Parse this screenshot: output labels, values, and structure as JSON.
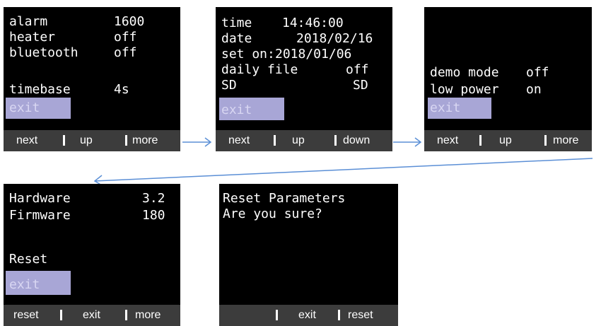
{
  "screens": {
    "s1": {
      "rows": [
        {
          "label": "alarm",
          "value": "1600"
        },
        {
          "label": "heater",
          "value": "off"
        },
        {
          "label": "bluetooth",
          "value": "off"
        },
        {
          "label": "timebase",
          "value": "4s"
        }
      ],
      "exit": "exit",
      "softkeys": [
        "next",
        "up",
        "more"
      ]
    },
    "s2": {
      "rows": [
        {
          "label": "time",
          "value": "14:46:00"
        },
        {
          "label": "date",
          "value": "2018/02/16"
        },
        {
          "label": "set on:",
          "value": "2018/01/06"
        },
        {
          "label": "daily file",
          "value": "off"
        },
        {
          "label": "SD",
          "value": "SD"
        }
      ],
      "exit": "exit",
      "softkeys": [
        "next",
        "up",
        "down"
      ]
    },
    "s3": {
      "rows": [
        {
          "label": "demo mode",
          "value": "off"
        },
        {
          "label": "low power",
          "value": "on"
        }
      ],
      "exit": "exit",
      "softkeys": [
        "next",
        "up",
        "more"
      ]
    },
    "s4": {
      "rows": [
        {
          "label": "Hardware",
          "value": "3.2"
        },
        {
          "label": "Firmware",
          "value": "180"
        }
      ],
      "reset": "Reset",
      "exit": "exit",
      "softkeys": [
        "reset",
        "exit",
        "more"
      ]
    },
    "s5": {
      "lines": [
        "Reset Parameters",
        "Are you sure?"
      ],
      "softkeys": [
        "",
        "exit",
        "reset"
      ]
    }
  },
  "colors": {
    "screen_bg": "#000000",
    "text": "#ffffff",
    "highlight": "#a8a6d6",
    "softkey_bar": "#3c3c3c",
    "arrow": "#5b8fd6"
  }
}
